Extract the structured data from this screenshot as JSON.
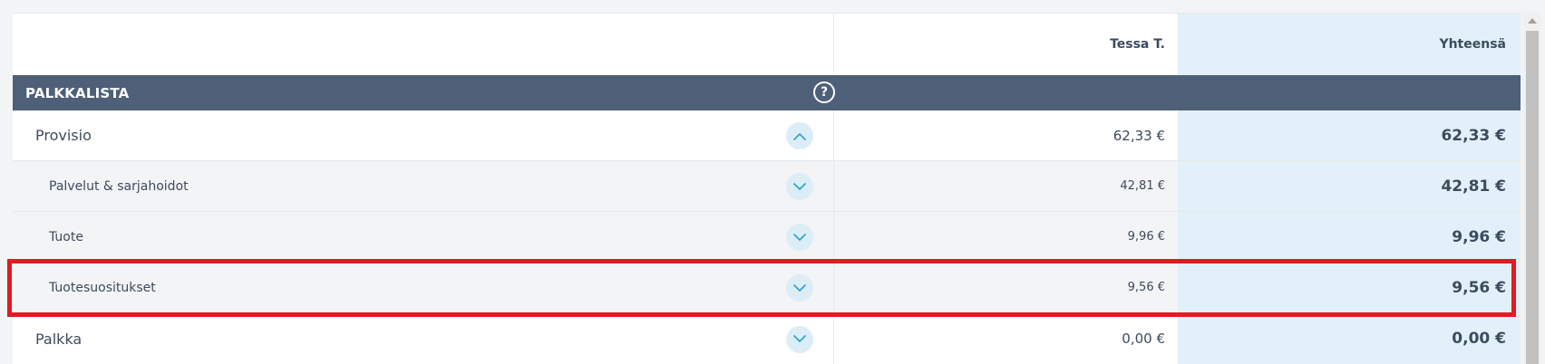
{
  "header": {
    "employee": "Tessa T.",
    "total": "Yhteensä"
  },
  "section": {
    "title": "PALKKALISTA",
    "help_icon": "?"
  },
  "rows": [
    {
      "label": "Provisio",
      "value": "62,33 €",
      "total": "62,33 €",
      "level": 0,
      "toggle_icon": "chevron-up-icon"
    },
    {
      "label": "Palvelut & sarjahoidot",
      "value": "42,81 €",
      "total": "42,81 €",
      "level": 1,
      "toggle_icon": "chevron-down-icon"
    },
    {
      "label": "Tuote",
      "value": "9,96 €",
      "total": "9,96 €",
      "level": 1,
      "toggle_icon": "chevron-down-icon"
    },
    {
      "label": "Tuotesuositukset",
      "value": "9,56 €",
      "total": "9,56 €",
      "level": 1,
      "toggle_icon": "chevron-down-icon"
    },
    {
      "label": "Palkka",
      "value": "0,00 €",
      "total": "0,00 €",
      "level": 0,
      "toggle_icon": "chevron-down-icon"
    }
  ],
  "colors": {
    "section_bg": "#4e5f78",
    "total_column_bg": "#e2f1f9",
    "highlight": "#e01b22",
    "toggle_bg": "#dcedf6",
    "toggle_icon": "#2a9fd6"
  }
}
